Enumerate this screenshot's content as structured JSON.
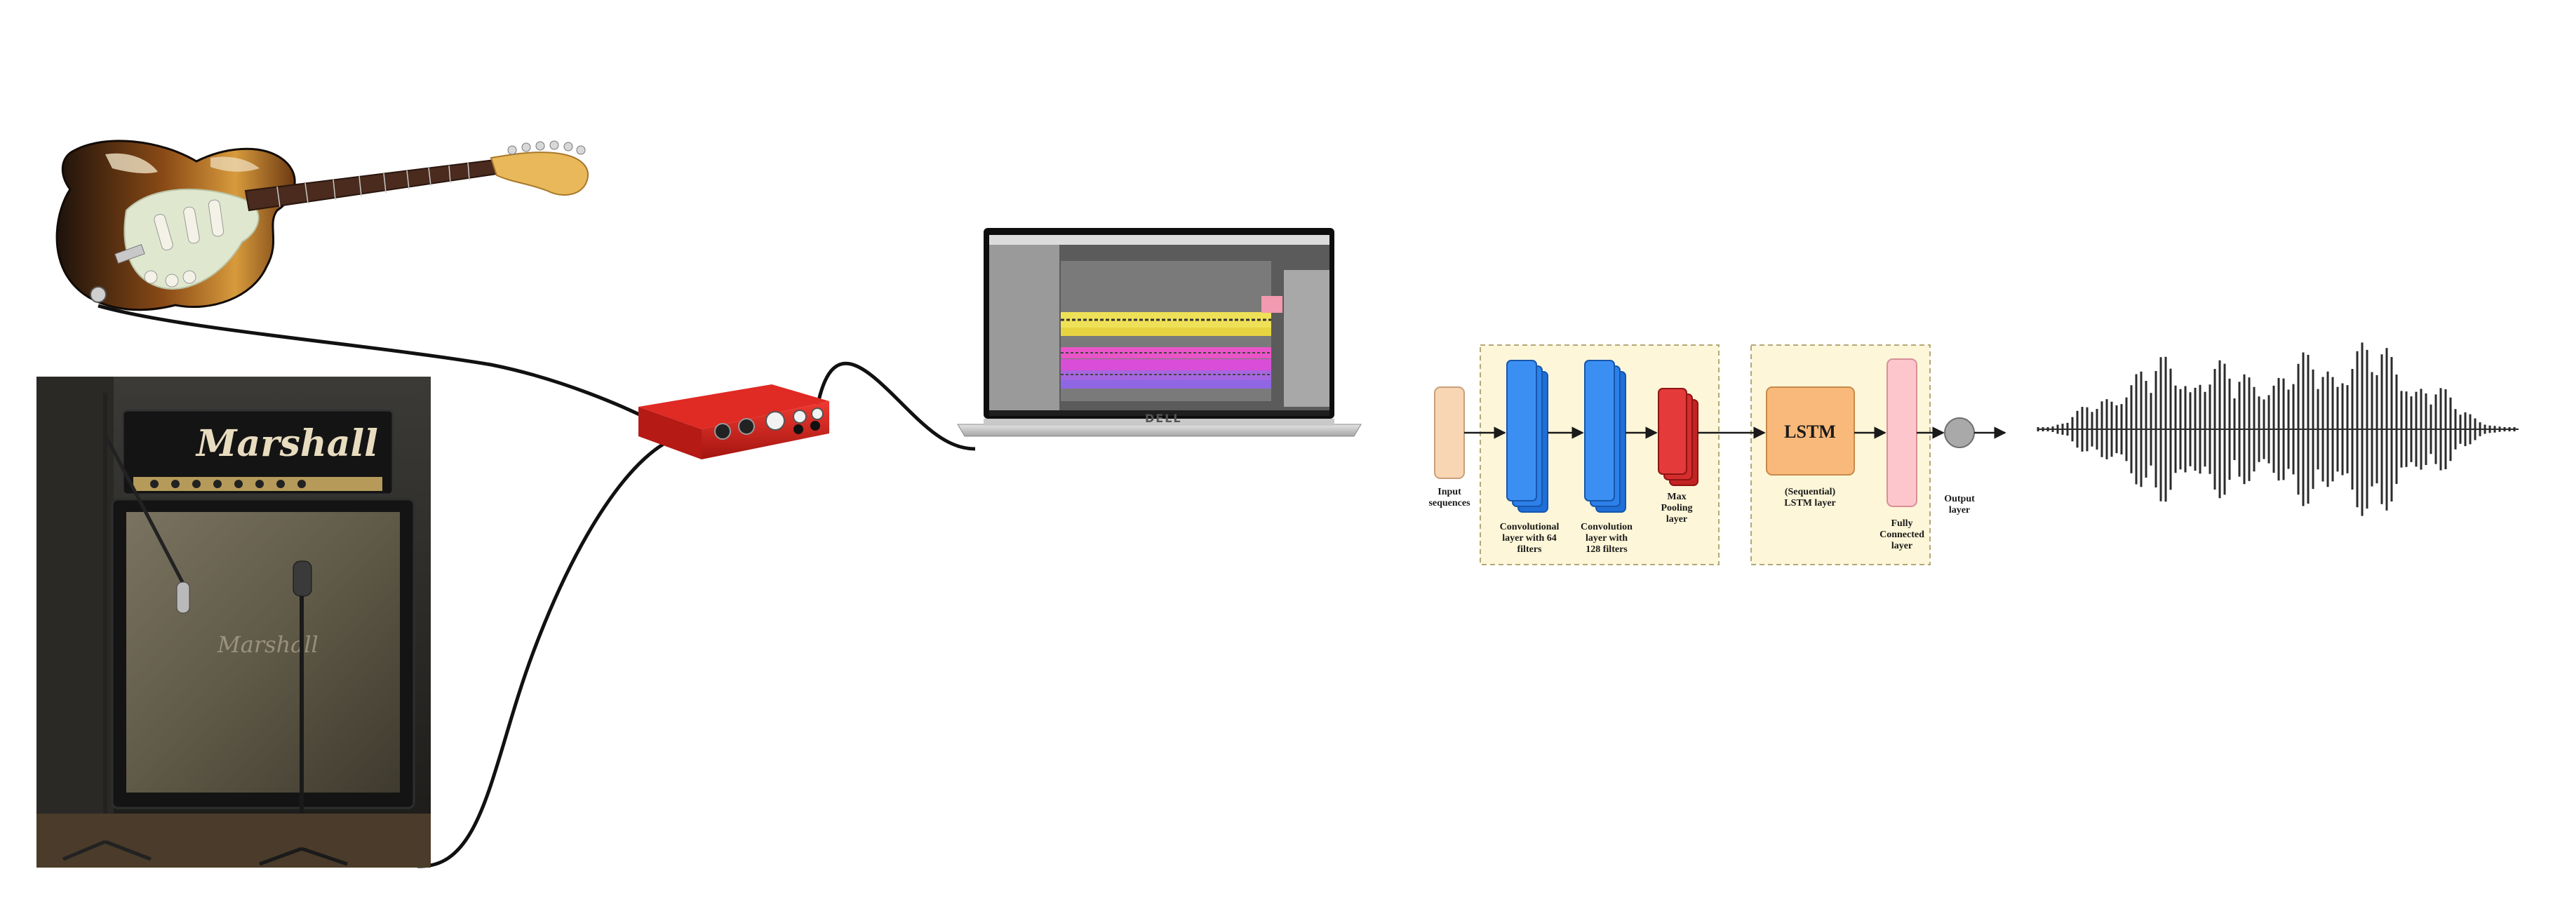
{
  "amp": {
    "brand": "Marshall",
    "cabinet_brand": "Marshall"
  },
  "laptop": {
    "brand": "DELL"
  },
  "network": {
    "input_label": "Input sequences",
    "conv64_label": "Convolutional layer with 64 filters",
    "conv128_label": "Convolution layer with 128 filters",
    "maxpool_label": "Max Pooling layer",
    "lstm_box_label": "LSTM",
    "lstm_label": "(Sequential) LSTM layer",
    "fc_label": "Fully Connected layer",
    "output_label": "Output layer"
  },
  "colors": {
    "input_block": "#f8d5b3",
    "conv_block": "#3b8ff3",
    "maxpool_block": "#e53a3a",
    "lstm_block": "#f9b97a",
    "fc_block": "#fdc6cc",
    "output_node": "#a9a9a9",
    "group_bg": "#fdf6d8",
    "interface_red": "#d7241f",
    "waveform": "#2b2b2b"
  }
}
